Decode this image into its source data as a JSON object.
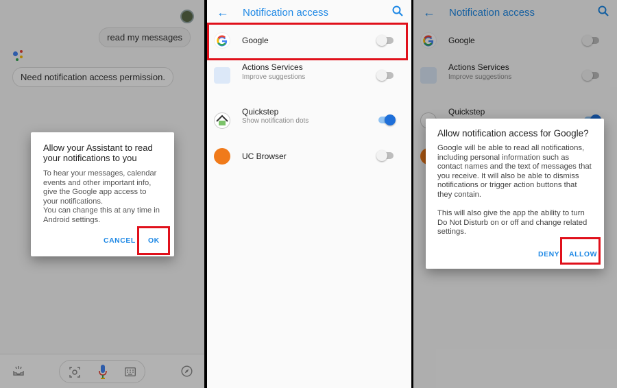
{
  "panel1": {
    "user_message": "read my messages",
    "assistant_message": "Need notification access permission.",
    "dialog": {
      "title": "Allow your Assistant to read your notifications to you",
      "body": "To hear your messages, calendar events and other important info, give the Google app access to your notifications.\nYou can change this at any time in Android settings.",
      "cancel": "CANCEL",
      "ok": "OK"
    },
    "bottom_icons": [
      "inbox-icon",
      "lens-icon",
      "mic-icon",
      "keyboard-icon",
      "compass-icon"
    ]
  },
  "settings": {
    "title": "Notification access",
    "apps": [
      {
        "name": "Google",
        "subtitle": "",
        "enabled": false
      },
      {
        "name": "Actions Services",
        "subtitle": "Improve suggestions",
        "enabled": false
      },
      {
        "name": "Quickstep",
        "subtitle": "Show notification dots",
        "enabled": true
      },
      {
        "name": "UC Browser",
        "subtitle": "",
        "enabled": false
      }
    ]
  },
  "panel3": {
    "dialog": {
      "title": "Allow notification access for Google?",
      "body": "Google will be able to read all notifications, including personal information such as contact names and the text of messages that you receive. It will also be able to dismiss notifications or trigger action buttons that they contain.\n\nThis will also give the app the ability to turn Do Not Disturb on or off and change related settings.",
      "deny": "DENY",
      "allow": "ALLOW"
    }
  },
  "colors": {
    "accent": "#1e88e5",
    "highlight": "#e0101b"
  }
}
